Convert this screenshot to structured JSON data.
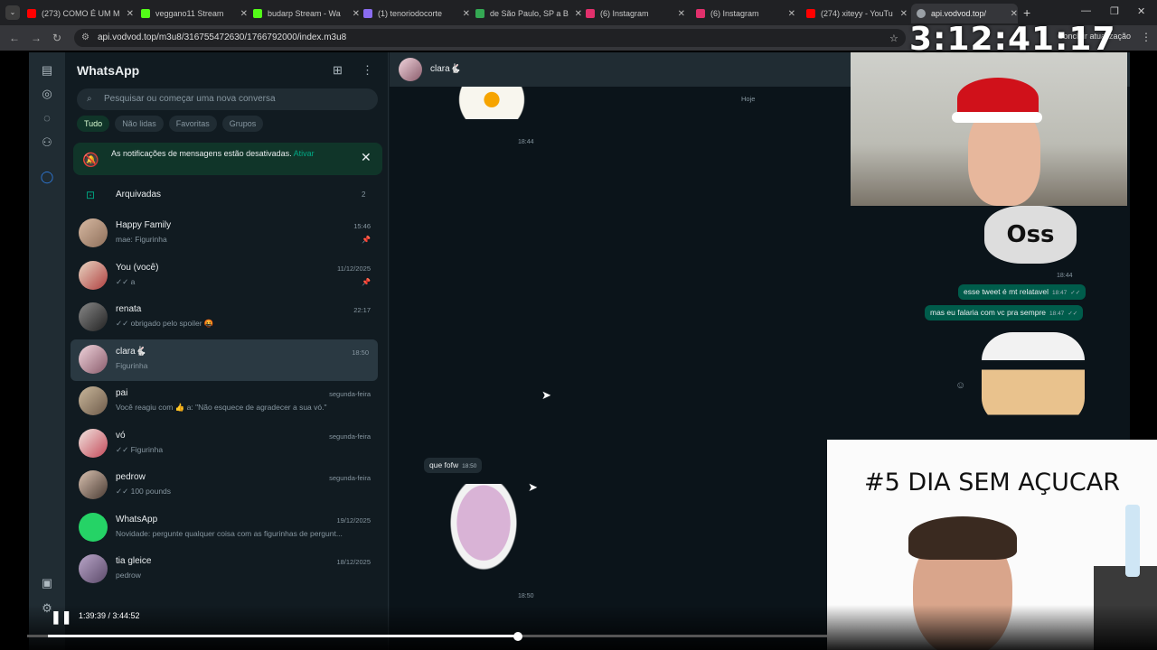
{
  "browser": {
    "tabs": [
      {
        "title": "(273) COMO É UM M",
        "color": "#ff0000"
      },
      {
        "title": "veggano11 Stream",
        "color": "#53fc18"
      },
      {
        "title": "budarp Stream - Wa",
        "color": "#53fc18"
      },
      {
        "title": "(1) tenoriodocorte",
        "color": "#8a6cf0"
      },
      {
        "title": "de São Paulo, SP a B",
        "color": "#34a853"
      },
      {
        "title": "(6) Instagram",
        "color": "#e1306c"
      },
      {
        "title": "(6) Instagram",
        "color": "#e1306c"
      },
      {
        "title": "(274) xiteyy - YouTu",
        "color": "#ff0000"
      },
      {
        "title": "api.vodvod.top/",
        "color": "#9aa0a6"
      }
    ],
    "url": "api.vodvod.top/m3u8/316755472630/1766792000/index.m3u8",
    "update_label": "Concluir atualização"
  },
  "overlay": {
    "clock": "3:12:41:17"
  },
  "whatsapp": {
    "title": "WhatsApp",
    "search_placeholder": "Pesquisar ou começar uma nova conversa",
    "filters": [
      "Tudo",
      "Não lidas",
      "Favoritas",
      "Grupos"
    ],
    "notification": {
      "text": "As notificações de mensagens estão desativadas.",
      "action": "Ativar"
    },
    "archived": {
      "label": "Arquivadas",
      "count": "2"
    },
    "chats": [
      {
        "name": "Happy Family",
        "preview": "mae: Figurinha",
        "time": "15:46",
        "pinned": true
      },
      {
        "name": "You (você)",
        "preview": "✓✓ a",
        "time": "11/12/2025",
        "pinned": true
      },
      {
        "name": "renata",
        "preview": "✓✓ obrigado pelo spoiler 🤬",
        "time": "22:17",
        "pinned": false
      },
      {
        "name": "clara🐇",
        "preview": "Figurinha",
        "time": "18:50",
        "pinned": false,
        "selected": true
      },
      {
        "name": "pai",
        "preview": "Você reagiu com 👍 a: \"Não esquece de agradecer a sua vó.\"",
        "time": "segunda-feira",
        "pinned": false
      },
      {
        "name": "vó",
        "preview": "✓✓ Figurinha",
        "time": "segunda-feira",
        "pinned": false
      },
      {
        "name": "pedrow",
        "preview": "✓✓ 100 pounds",
        "time": "segunda-feira",
        "pinned": false
      },
      {
        "name": "WhatsApp",
        "preview": "Novidade: pergunte qualquer coisa com as figurinhas de pergunt...",
        "time": "19/12/2025",
        "pinned": false
      },
      {
        "name": "tia gleice",
        "preview": "pedrow",
        "time": "18/12/2025",
        "pinned": false
      }
    ],
    "conversation": {
      "contact": "clara🐇",
      "day_label": "Hoje",
      "sticker_oss_text": "Oss",
      "stamps": [
        "18:44",
        "18:44",
        "18:50"
      ],
      "messages_out": [
        {
          "text": "esse tweet é mt relatavel",
          "time": "18:47"
        },
        {
          "text": "mas eu falaria com vc pra sempre",
          "time": "18:47"
        }
      ],
      "messages_in": [
        {
          "text": "que fofw",
          "time": "18:50"
        }
      ]
    }
  },
  "stream": {
    "caption": "#5 DIA SEM AÇUCAR"
  },
  "player": {
    "time": "1:39:39 / 3:44:52",
    "progress": 0.44
  }
}
